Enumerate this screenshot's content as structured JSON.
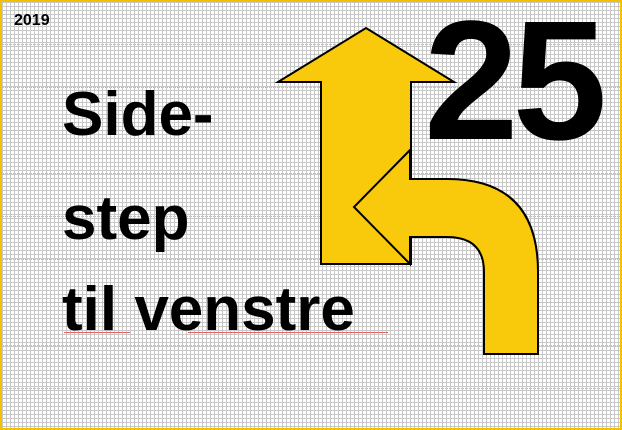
{
  "slide": {
    "year": "2019",
    "number": "25",
    "title_lines": [
      "Side-",
      "step",
      "til venstre"
    ],
    "arrow_color": "#F9CA0C",
    "icon": "sidestep-left-arrow-icon"
  }
}
